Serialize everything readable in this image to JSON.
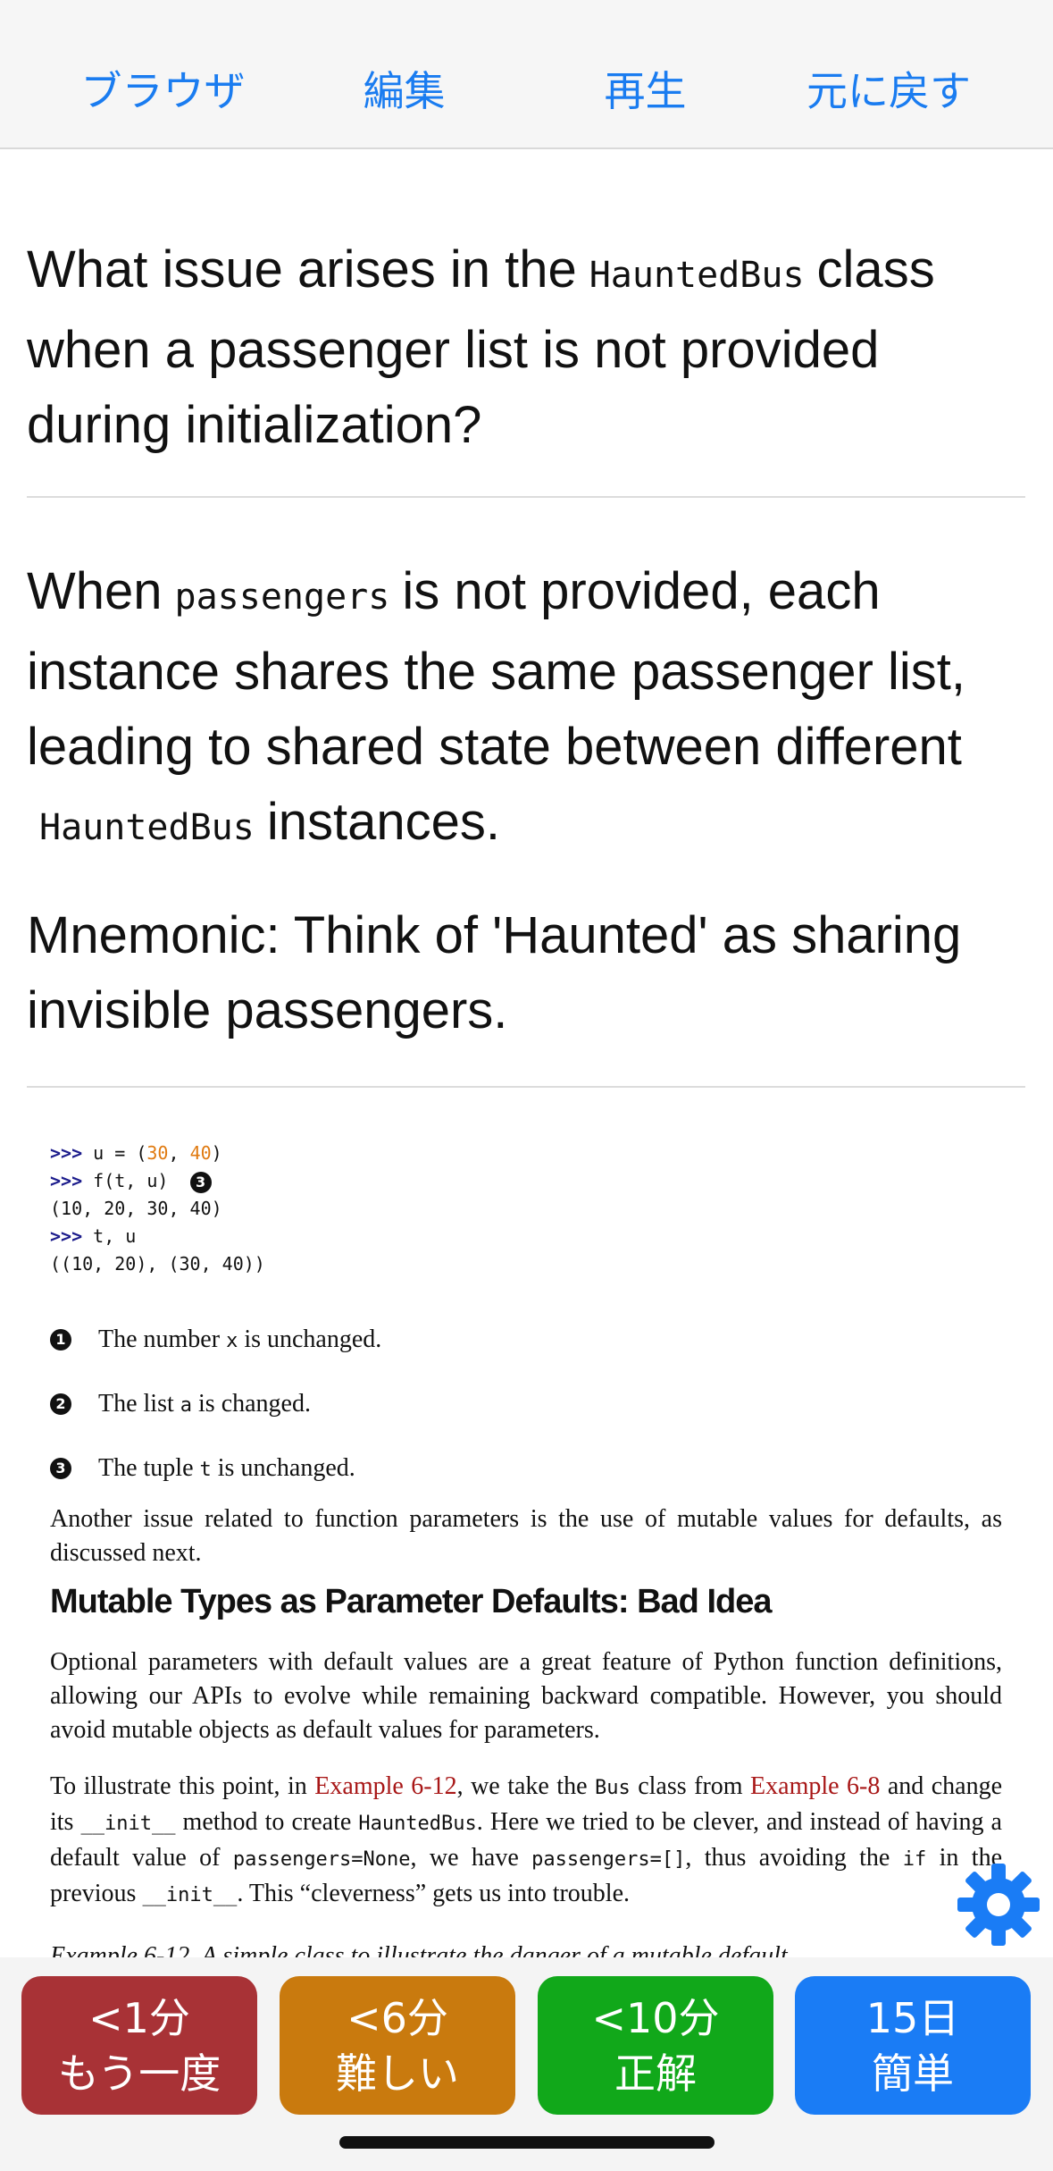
{
  "toolbar": {
    "browser": "ブラウザ",
    "edit": "編集",
    "replay": "再生",
    "undo": "元に戻す"
  },
  "question": {
    "part1": "What issue arises in the",
    "code": "HauntedBus",
    "part2": "class when a passenger list is not provided during initialization?"
  },
  "answer": {
    "part1": "When",
    "code1": "passengers",
    "part2": "is not provided, each instance shares the same passenger list, leading to shared state between different",
    "code2": "HauntedBus",
    "part3": "instances."
  },
  "mnemonic": "Mnemonic: Think of 'Haunted' as sharing invisible passengers.",
  "book": {
    "code_lines": [
      {
        "prompt": ">>>",
        "text": " u = (",
        "n1": "30",
        "sep": ", ",
        "n2": "40",
        "end": ")"
      },
      {
        "prompt": ">>>",
        "text": " f(t, u)",
        "callout": "3"
      },
      {
        "text": "(10, 20, 30, 40)"
      },
      {
        "prompt": ">>>",
        "text": " t, u"
      },
      {
        "text": "((10, 20), (30, 40))"
      }
    ],
    "annotations": [
      {
        "num": "1",
        "pre": "The number ",
        "code": "x",
        "post": " is unchanged."
      },
      {
        "num": "2",
        "pre": "The list ",
        "code": "a",
        "post": " is changed."
      },
      {
        "num": "3",
        "pre": "The tuple ",
        "code": "t",
        "post": " is unchanged."
      }
    ],
    "para1": "Another issue related to function parameters is the use of mutable values for defaults, as discussed next.",
    "heading": "Mutable Types as Parameter Defaults: Bad Idea",
    "para2": "Optional parameters with default values are a great feature of Python function definitions, allowing our APIs to evolve while remaining backward compatible. However, you should avoid mutable objects as default values for parameters.",
    "para3": {
      "s1": "To illustrate this point, in ",
      "link1": "Example 6-12",
      "s2": ", we take the ",
      "c1": "Bus",
      "s3": " class from ",
      "link2": "Example 6-8",
      "s4": " and change its ",
      "c2": "__init__",
      "s5": " method to create ",
      "c3": "HauntedBus",
      "s6": ". Here we tried to be clever, and instead of having a default value of ",
      "c4": "passengers=None",
      "s7": ", we have ",
      "c5": "passengers=[]",
      "s8": ", thus avoiding the ",
      "c6": "if",
      "s9": " in the previous ",
      "c7": "__init__",
      "s10": ". This “cleverness” gets us into trouble."
    },
    "cutoff": "Example 6-12. A simple class to illustrate the danger of a mutable default"
  },
  "answer_buttons": [
    {
      "time": "<1分",
      "label": "もう一度",
      "color": "#a83236"
    },
    {
      "time": "<6分",
      "label": "難しい",
      "color": "#c97a0e"
    },
    {
      "time": "<10分",
      "label": "正解",
      "color": "#11a81a"
    },
    {
      "time": "15日",
      "label": "簡単",
      "color": "#1a7cf5"
    }
  ],
  "colors": {
    "accent": "#1a7cf0",
    "gear": "#1a7cf5"
  },
  "icons": {
    "settings": "gear-icon"
  }
}
